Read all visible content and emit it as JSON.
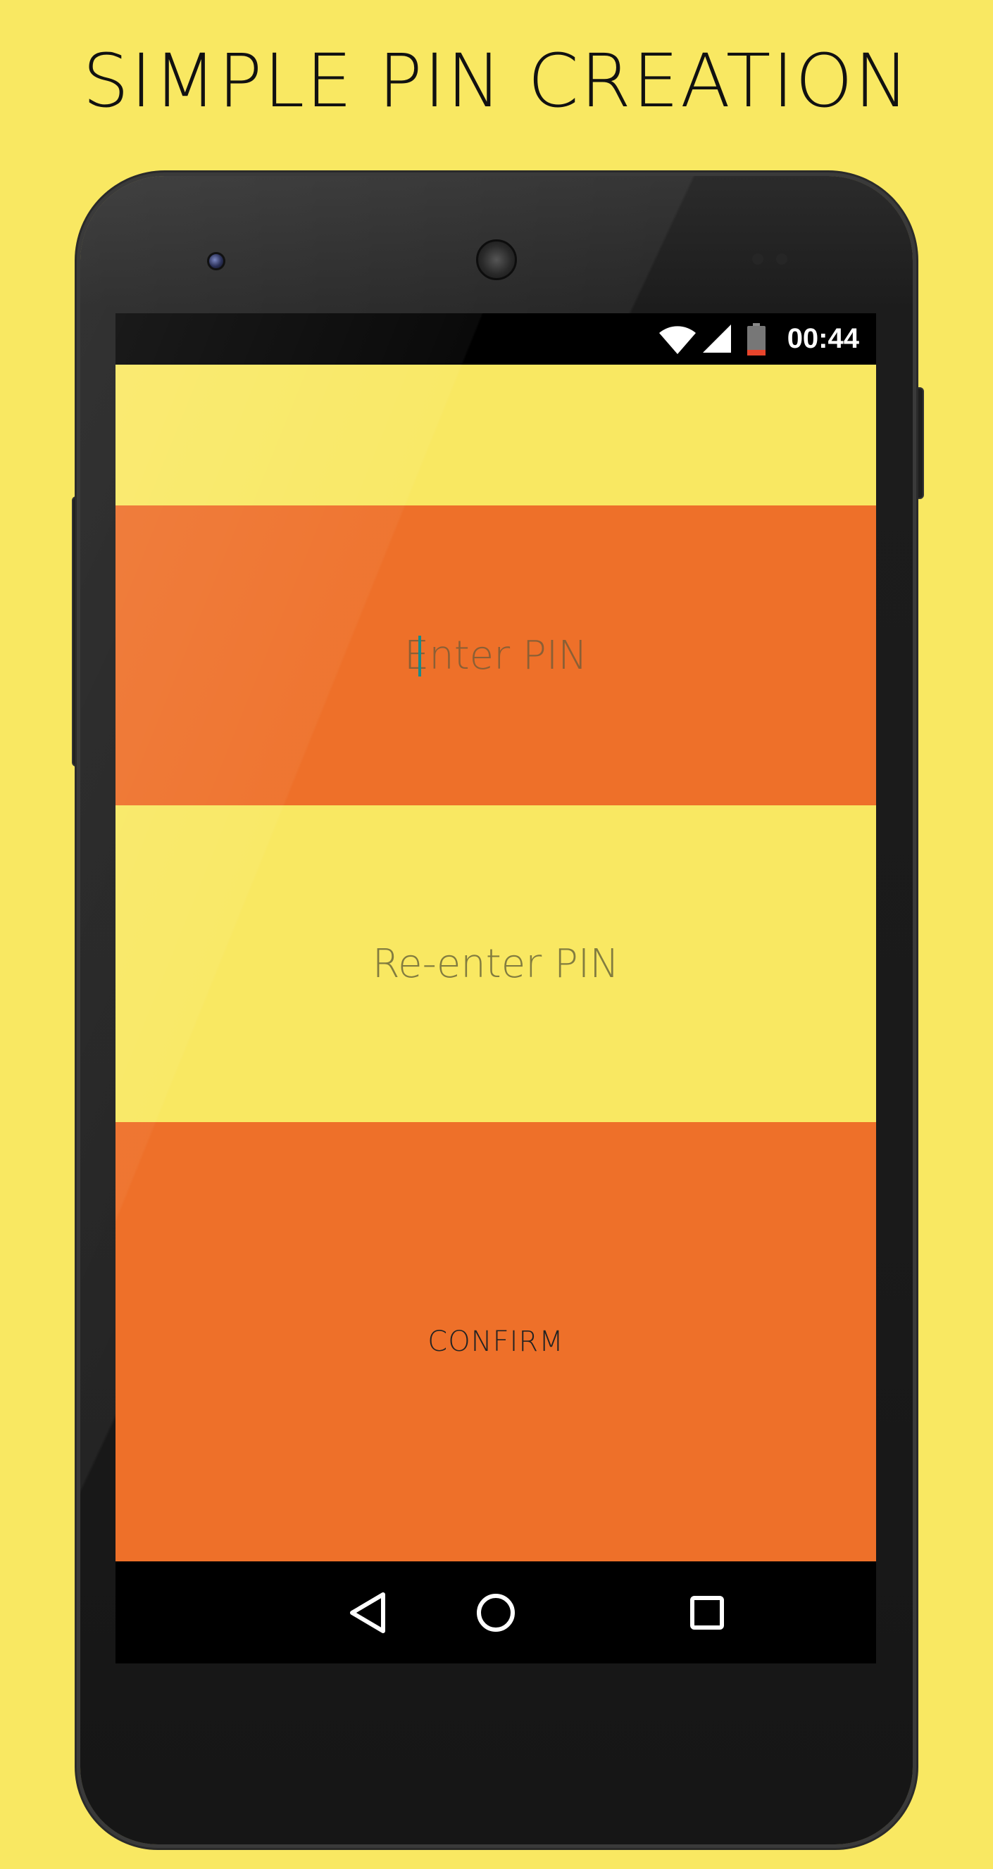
{
  "headline": "SIMPLE PIN CREATION",
  "status_bar": {
    "time": "00:44",
    "icons": [
      "wifi-icon",
      "cellular-signal-icon",
      "battery-low-icon"
    ]
  },
  "form": {
    "pin_placeholder": "Enter PIN",
    "repin_placeholder": "Re-enter PIN",
    "confirm_label": "CONFIRM"
  },
  "nav_bar": {
    "icons": [
      "back-icon",
      "home-icon",
      "recents-icon"
    ]
  },
  "colors": {
    "background": "#F9E862",
    "accent_orange": "#EE7029",
    "cursor": "#1a8a8a"
  }
}
